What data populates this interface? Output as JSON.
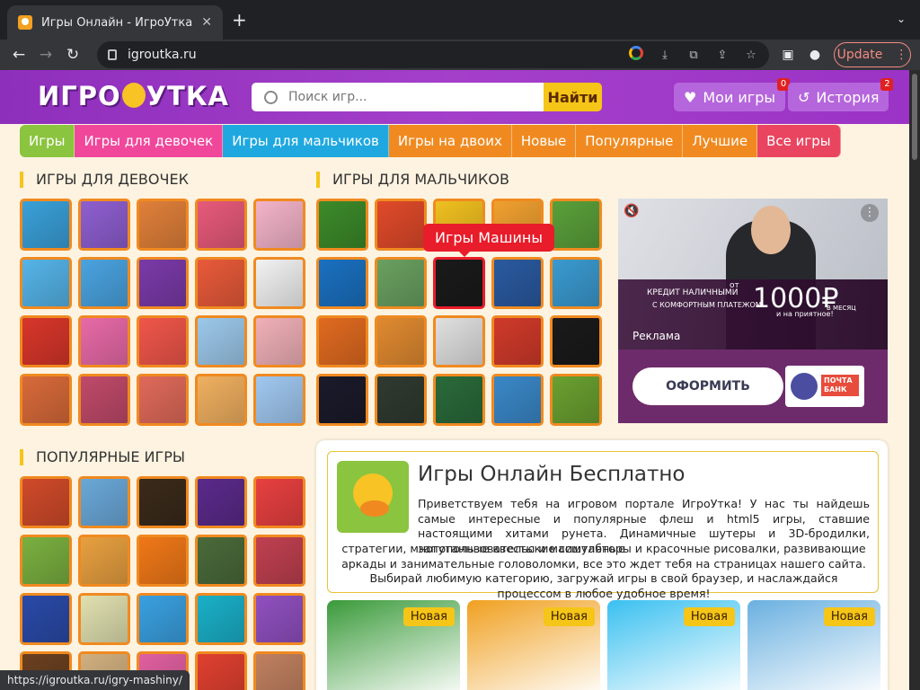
{
  "browser": {
    "tab_title": "Игры Онлайн - ИгроУтка",
    "tab_close": "✕",
    "new_tab": "+",
    "url": "igroutka.ru",
    "update_label": "Update",
    "status_url": "https://igroutka.ru/igry-mashiny/"
  },
  "site": {
    "logo_left": "ИГРО",
    "logo_right": "УТКА",
    "search_placeholder": "Поиск игр...",
    "search_button": "Найти",
    "my_games": "Мои игры",
    "my_games_count": "0",
    "history": "История",
    "history_count": "2"
  },
  "nav": [
    {
      "label": "Игры",
      "color": "#8bc43f"
    },
    {
      "label": "Игры для девочек",
      "color": "#f0479b"
    },
    {
      "label": "Игры для мальчиков",
      "color": "#1fa8e0"
    },
    {
      "label": "Игры на двоих",
      "color": "#f08a20"
    },
    {
      "label": "Новые",
      "color": "#f08a20"
    },
    {
      "label": "Популярные",
      "color": "#f08a20"
    },
    {
      "label": "Лучшие",
      "color": "#f08a20"
    },
    {
      "label": "Все игры",
      "color": "#e94560"
    }
  ],
  "sections": {
    "girls": "ИГРЫ ДЛЯ ДЕВОЧЕК",
    "boys": "ИГРЫ ДЛЯ МАЛЬЧИКОВ",
    "popular": "ПОПУЛЯРНЫЕ ИГРЫ"
  },
  "tooltip": "Игры Машины",
  "ad": {
    "credit_line1": "КРЕДИТ НАЛИЧНЫМИ",
    "credit_line2": "С КОМФОРТНЫМ ПЛАТЕЖОМ",
    "from": "от",
    "amount": "1000₽",
    "per_month": "В МЕСЯЦ",
    "pleasant": "и на приятное!",
    "label": "Реклама",
    "button": "ОФОРМИТЬ",
    "bank": "ПОЧТА БАНК"
  },
  "intro": {
    "title": "Игры Онлайн Бесплатно",
    "text1": "Приветствуем тебя на игровом портале ИгроУтка! У нас ты найдешь самые интересные и популярные флеш и html5 игры, ставшие настоящими хитами рунета. Динамичные шутеры и 3D-бродилки, запутанные квесты и масштабные",
    "text2": "стратегии, многопользовательские симуляторы и красочные рисовалки, развивающие аркады и занимательные головоломки, все это ждет тебя на страницах нашего сайта. Выбирай любимую категорию, загружай игры в свой браузер, и наслаждайся процессом в любое удобное время!",
    "badge": "Новая"
  },
  "tile_colors": {
    "girls": [
      "#3aa0d8",
      "#8e5fd0",
      "#e0803a",
      "#e75a7a",
      "#f3b3c8",
      "#55b4e8",
      "#4aa3e0",
      "#7a3aa8",
      "#e85a3a",
      "#f2f2f2",
      "#d8362a",
      "#e86aa8",
      "#f0564a",
      "#9cc8ea",
      "#f0b0b8",
      "#d86a3a",
      "#c04a6a",
      "#e06a5a",
      "#f0b060",
      "#a0c8f0"
    ],
    "boys": [
      "#3c8a2a",
      "#e04a2a",
      "#f0c020",
      "#f0a030",
      "#5aa03a",
      "#1a70c0",
      "#6aa060",
      "#1a1a1a",
      "#2a5aa0",
      "#3a9ad0",
      "#e06a20",
      "#e08a30",
      "#e0e0e0",
      "#d03a2a",
      "#1a1a1a",
      "#1a1a2a",
      "#303a30",
      "#2a6a3a",
      "#3a88c8",
      "#6aa030"
    ],
    "popular": [
      "#d04a2a",
      "#6aa8d8",
      "#3a2a1a",
      "#5a2a8a",
      "#e84040",
      "#7ab040",
      "#e8a040",
      "#f07818",
      "#4a6a3a",
      "#c04050",
      "#2a4aa8",
      "#e0e0b0",
      "#3aa0e0",
      "#1ab0c8",
      "#9050c0",
      "#6a4020",
      "#d0b080",
      "#e060a0",
      "#e04030",
      "#c08060"
    ],
    "cards": [
      "#3a9a3a",
      "#f0a020",
      "#3ac0f0",
      "#6ab0e0"
    ]
  }
}
